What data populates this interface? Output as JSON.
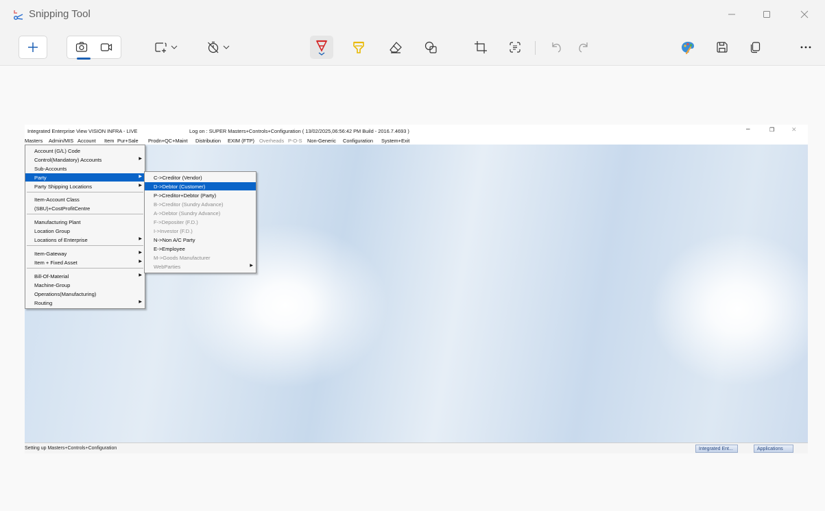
{
  "app": {
    "title": "Snipping Tool"
  },
  "erp": {
    "title_left": "Integrated Enterprise View  VISION INFRA - LIVE",
    "title_right": "Log on : SUPER  Masters+Controls+Configuration ( 13/02/2025,06:56:42 PM Build - 2016.7.4693 )",
    "menubar": [
      {
        "label": "Masters",
        "dim": false
      },
      {
        "label": "Admin/MIS",
        "dim": false
      },
      {
        "label": "Account",
        "dim": false
      },
      {
        "label": "Item",
        "dim": false
      },
      {
        "label": "Pur+Sale",
        "dim": false
      },
      {
        "label": "Prodn+QC+Maint",
        "dim": false
      },
      {
        "label": "Distribution",
        "dim": false
      },
      {
        "label": "EXIM (FTP)",
        "dim": false
      },
      {
        "label": "Overheads",
        "dim": true
      },
      {
        "label": "P-O-S",
        "dim": true
      },
      {
        "label": "Non-Generic",
        "dim": false
      },
      {
        "label": "Configuration",
        "dim": false
      },
      {
        "label": "System+Exit",
        "dim": false
      }
    ],
    "masters_menu": [
      "Account (G/L) Code",
      "Control(Mandatory) Accounts",
      "Sub-Accounts",
      "Party",
      "Party Shipping Locations",
      "Item-Account Class",
      "(SBU)+CostProfitCentre",
      "Manufacturing Plant",
      "Location Group",
      "Locations of Enterprise",
      "Item-Gateway",
      "Item + Fixed Asset",
      "Bill-Of-Material",
      "Machine-Group",
      "Operations(Manufacturing)",
      "Routing"
    ],
    "party_menu": [
      "C->Creditor (Vendor)",
      "D->Debtor (Customer)",
      "P->Creditor+Debtor (Party)",
      "B->Creditor (Sundry Advance)",
      "A->Debtor (Sundry Advance)",
      "F->Depositer (F.D.)",
      "I->Investor (F.D.)",
      "N->Non A/C Party",
      "E->Employee",
      "M->Goods Manufacturer",
      "WebParties"
    ],
    "status_text": "Setting up Masters+Controls+Configuration",
    "taskbar": [
      "Integrated Ent...",
      "Applications"
    ]
  }
}
